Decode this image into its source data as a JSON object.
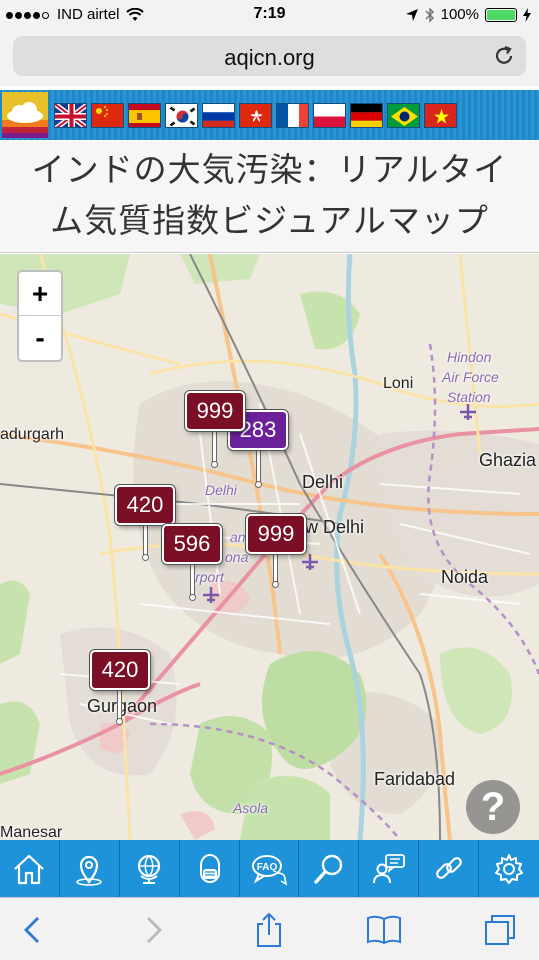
{
  "status_bar": {
    "carrier": "IND airtel",
    "time": "7:19",
    "battery": "100%",
    "battery_level": 1.0
  },
  "browser": {
    "url": "aqicn.org"
  },
  "flags": [
    "uk",
    "china",
    "spain",
    "korea",
    "russia",
    "hong-kong",
    "france",
    "poland",
    "germany",
    "brazil",
    "vietnam"
  ],
  "title": {
    "line1": "インドの大気汚染：リアルタイ",
    "line2": "ム気質指数ビジュアルマップ"
  },
  "map": {
    "zoom_in": "+",
    "zoom_out": "-",
    "places": {
      "loni": "Loni",
      "hindon_1": "Hindon",
      "hindon_2": "Air Force",
      "hindon_3": "Station",
      "bahadurgarh": "adurgarh",
      "ghaziabad": "Ghazia",
      "delhi": "Delhi",
      "delhi_italic": "Delhi",
      "new_delhi": "w Delhi",
      "noida": "Noida",
      "gurgaon": "Gurgaon",
      "faridabad": "Faridabad",
      "asola": "Asola",
      "manesar": "Manesar",
      "indira_1": "and",
      "indira_2": "ona",
      "indira_3": "irport"
    },
    "markers": [
      "999",
      "283",
      "420",
      "596",
      "999",
      "420"
    ],
    "help": "?"
  },
  "bottom_nav": [
    "home-icon",
    "location-pin-icon",
    "globe-icon",
    "mask-icon",
    "faq-icon",
    "search-icon",
    "forum-icon",
    "link-icon",
    "gear-icon"
  ],
  "colors": {
    "marker_hazardous": "#7a0f25",
    "marker_very_unhealthy": "#6a2199",
    "nav_blue": "#1f93d9"
  }
}
